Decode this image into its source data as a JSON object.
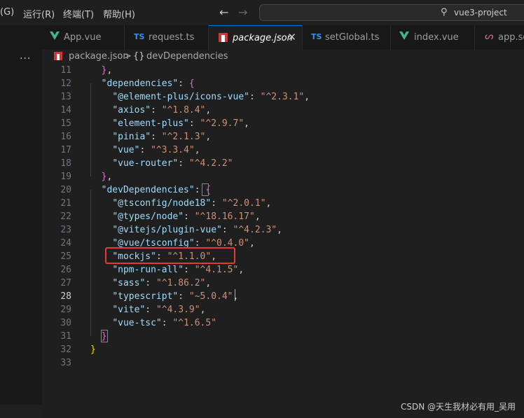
{
  "menu": [
    {
      "label": "(G)"
    },
    {
      "label": "运行(R)"
    },
    {
      "label": "终端(T)"
    },
    {
      "label": "帮助(H)"
    }
  ],
  "nav": {
    "back": "←",
    "forward": "→"
  },
  "search": {
    "icon": "⚲",
    "text": "vue3-project"
  },
  "more": "···",
  "tabs": [
    {
      "label": "App.vue",
      "icon": "vue"
    },
    {
      "label": "request.ts",
      "icon": "ts"
    },
    {
      "label": "package.json",
      "icon": "npm",
      "active": true
    },
    {
      "label": "setGlobal.ts",
      "icon": "ts"
    },
    {
      "label": "index.vue",
      "icon": "vue"
    },
    {
      "label": "app.sc",
      "icon": "sass"
    }
  ],
  "tab_icon_text": {
    "ts": "TS",
    "close": "✕",
    "sass": "ᔕ"
  },
  "breadcrumb": {
    "file": "package.json",
    "sep": ">",
    "symbol_icon": "{}",
    "symbol": "devDependencies"
  },
  "code_lines": [
    {
      "n": "11",
      "t": "  },"
    },
    {
      "n": "12",
      "t": "  \"dependencies\": {"
    },
    {
      "n": "13",
      "t": "    \"@element-plus/icons-vue\": \"^2.3.1\","
    },
    {
      "n": "14",
      "t": "    \"axios\": \"^1.8.4\","
    },
    {
      "n": "15",
      "t": "    \"element-plus\": \"^2.9.7\","
    },
    {
      "n": "16",
      "t": "    \"pinia\": \"^2.1.3\","
    },
    {
      "n": "17",
      "t": "    \"vue\": \"^3.3.4\","
    },
    {
      "n": "18",
      "t": "    \"vue-router\": \"^4.2.2\""
    },
    {
      "n": "19",
      "t": "  },"
    },
    {
      "n": "20",
      "t": "  \"devDependencies\": {"
    },
    {
      "n": "21",
      "t": "    \"@tsconfig/node18\": \"^2.0.1\","
    },
    {
      "n": "22",
      "t": "    \"@types/node\": \"^18.16.17\","
    },
    {
      "n": "23",
      "t": "    \"@vitejs/plugin-vue\": \"^4.2.3\","
    },
    {
      "n": "24",
      "t": "    \"@vue/tsconfig\": \"^0.4.0\","
    },
    {
      "n": "25",
      "t": "    \"mockjs\": \"^1.1.0\","
    },
    {
      "n": "26",
      "t": "    \"npm-run-all\": \"^4.1.5\","
    },
    {
      "n": "27",
      "t": "    \"sass\": \"^1.86.2\","
    },
    {
      "n": "28",
      "t": "    \"typescript\": \"~5.0.4\","
    },
    {
      "n": "29",
      "t": "    \"vite\": \"^4.3.9\","
    },
    {
      "n": "30",
      "t": "    \"vue-tsc\": \"^1.6.5\""
    },
    {
      "n": "31",
      "t": "  }"
    },
    {
      "n": "32",
      "t": "}"
    },
    {
      "n": "33",
      "t": ""
    }
  ],
  "current_line": "28",
  "watermark": "CSDN @天生我材必有用_吴用",
  "colors": {
    "accent": "#0078d4",
    "highlight_box": "#e53935",
    "key": "#9cdcfe",
    "string": "#ce9178"
  }
}
